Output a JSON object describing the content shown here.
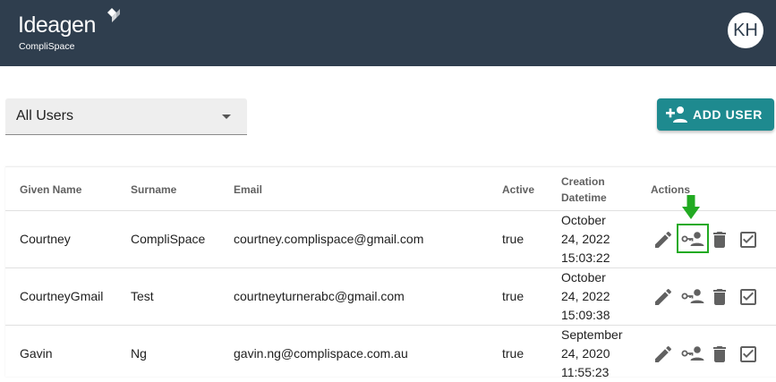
{
  "header": {
    "logo_main": "Ideagen",
    "logo_sub": "CompliSpace",
    "avatar_initials": "KH",
    "bg_color": "#2f3e4e"
  },
  "filter": {
    "selected": "All Users"
  },
  "add_user": {
    "label": "ADD USER",
    "color": "#1e8a8f",
    "icon": "person-add-icon"
  },
  "table": {
    "columns": [
      "Given Name",
      "Surname",
      "Email",
      "Active",
      "Creation Datetime",
      "Actions"
    ],
    "rows": [
      {
        "given": "Courtney",
        "surname": "CompliSpace",
        "email": "courtney.complispace@gmail.com",
        "active": "true",
        "date1": "October",
        "date2": "24, 2022",
        "date3": "15:03:22"
      },
      {
        "given": "CourtneyGmail",
        "surname": "Test",
        "email": "courtneyturnerabc@gmail.com",
        "active": "true",
        "date1": "October",
        "date2": "24, 2022",
        "date3": "15:09:38"
      },
      {
        "given": "Gavin",
        "surname": "Ng",
        "email": "gavin.ng@complispace.com.au",
        "active": "true",
        "date1": "September",
        "date2": "24, 2020",
        "date3": "11:55:23"
      }
    ],
    "action_icons": [
      "edit-icon",
      "user-key-icon",
      "delete-icon",
      "checkbox-icon"
    ]
  },
  "annotation": {
    "highlight_color": "#22aa22"
  }
}
